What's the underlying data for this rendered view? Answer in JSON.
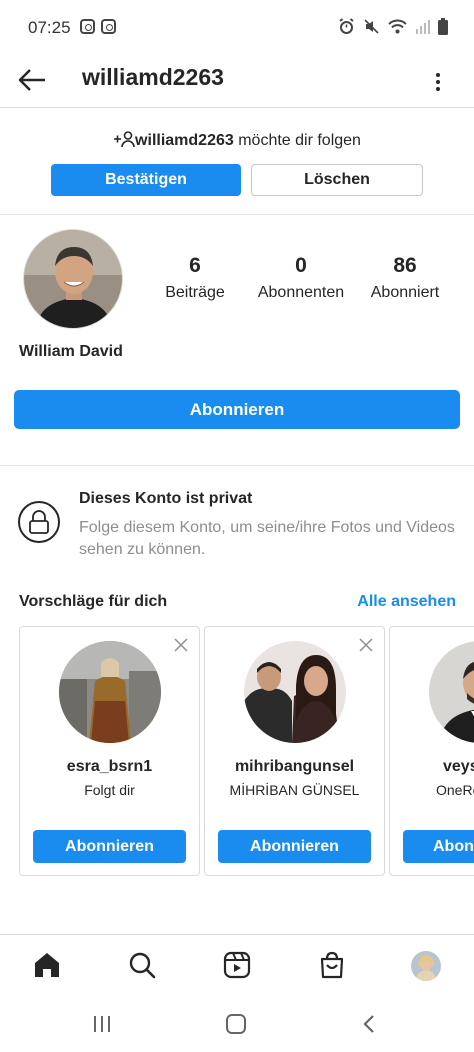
{
  "status_bar": {
    "time": "07:25"
  },
  "header": {
    "title": "williamd2263"
  },
  "follow_request": {
    "username": "williamd2263",
    "text": " möchte dir folgen",
    "confirm_label": "Bestätigen",
    "delete_label": "Löschen"
  },
  "profile": {
    "full_name": "William David",
    "stats": [
      {
        "value": "6",
        "label": "Beiträge"
      },
      {
        "value": "0",
        "label": "Abonnenten"
      },
      {
        "value": "86",
        "label": "Abonniert"
      }
    ],
    "follow_label": "Abonnieren"
  },
  "private": {
    "title": "Dieses Konto ist privat",
    "description": "Folge diesem Konto, um seine/ihre Fotos und Videos sehen zu können."
  },
  "suggestions": {
    "title": "Vorschläge für dich",
    "see_all": "Alle ansehen",
    "cards": [
      {
        "username": "esra_bsrn1",
        "subtitle": "Folgt dir",
        "button": "Abonnieren"
      },
      {
        "username": "mihribangunsel",
        "subtitle": "MİHRİBAN GÜNSEL",
        "button": "Abonnieren"
      },
      {
        "username": "veys",
        "subtitle": "OneRe",
        "button": "Abon"
      }
    ]
  },
  "tabs": [
    "home-icon",
    "search-icon",
    "reels-icon",
    "shop-icon",
    "profile-avatar"
  ],
  "colors": {
    "accent": "#1a8cf0",
    "text": "#262626",
    "muted": "#8e8e8e",
    "border": "#dbdbdb"
  }
}
